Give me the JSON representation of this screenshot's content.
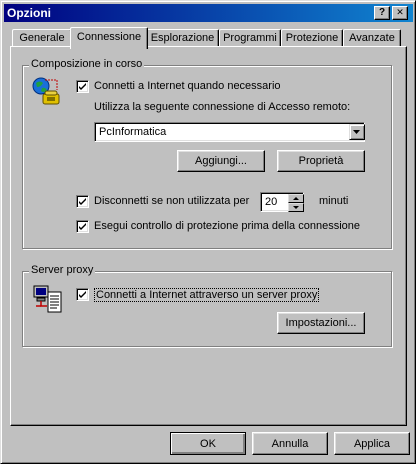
{
  "window": {
    "title": "Opzioni",
    "help_glyph": "?",
    "close_glyph": "✕"
  },
  "tabs": [
    {
      "label": "Generale",
      "active": false
    },
    {
      "label": "Connessione",
      "active": true
    },
    {
      "label": "Esplorazione",
      "active": false
    },
    {
      "label": "Programmi",
      "active": false
    },
    {
      "label": "Protezione",
      "active": false
    },
    {
      "label": "Avanzate",
      "active": false
    }
  ],
  "dialing": {
    "legend": "Composizione in corso",
    "icon": "phone-globe-icon",
    "connect_when_needed": {
      "label": "Connetti a Internet quando necessario",
      "checked": true
    },
    "use_connection_label": "Utilizza la seguente connessione di Accesso remoto:",
    "connection_select": {
      "value": "PcInformatica"
    },
    "add_label": "Aggiungi...",
    "properties_label": "Proprietà",
    "disconnect_idle": {
      "label": "Disconnetti se non utilizzata per",
      "checked": true,
      "value": "20",
      "unit": "minuti"
    },
    "security_check": {
      "label": "Esegui controllo di protezione prima della connessione",
      "checked": true
    }
  },
  "proxy": {
    "legend": "Server proxy",
    "icon": "network-computer-icon",
    "use_proxy": {
      "label": "Connetti a Internet attraverso un server proxy",
      "checked": true
    },
    "settings_label": "Impostazioni..."
  },
  "footer": {
    "ok_label": "OK",
    "cancel_label": "Annulla",
    "apply_label": "Applica"
  },
  "colors": {
    "title_start": "#000080",
    "title_end": "#1084d0",
    "face": "#c0c0c0"
  }
}
